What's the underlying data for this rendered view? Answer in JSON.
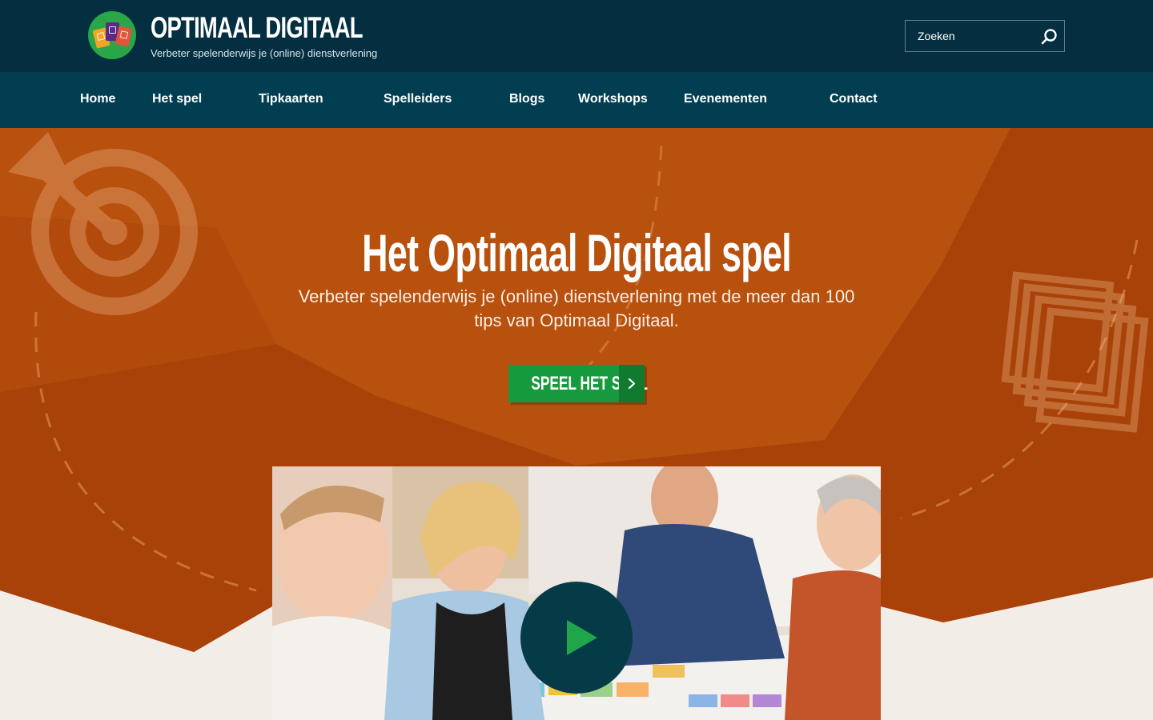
{
  "header": {
    "brand_title": "OPTIMAAL DIGITAAL",
    "brand_tagline": "Verbeter spelenderwijs je (online) dienstverlening",
    "search_placeholder": "Zoeken"
  },
  "nav": {
    "items": [
      {
        "label": "Home"
      },
      {
        "label": "Het spel"
      },
      {
        "label": "Tipkaarten"
      },
      {
        "label": "Spelleiders"
      },
      {
        "label": "Blogs"
      },
      {
        "label": "Workshops"
      },
      {
        "label": "Evenementen"
      },
      {
        "label": "Contact"
      }
    ]
  },
  "hero": {
    "title": "Het Optimaal Digitaal spel",
    "subtitle": "Verbeter spelenderwijs je (online) dienstverlening met de meer dan 100 tips van Optimaal Digitaal.",
    "cta_label": "SPEEL HET SPEL"
  },
  "icons": {
    "search": "search-icon",
    "cta_arrow": "chevron-right-icon",
    "play": "play-icon",
    "target": "target-arrow-icon",
    "cards": "card-stack-icon"
  },
  "colors": {
    "header_bg": "#032f40",
    "nav_bg": "#023e52",
    "hero_orange": "#b8500e",
    "hero_orange_dark": "#a84208",
    "cta_green": "#179a3e",
    "play_bg": "#053a47",
    "play_triangle": "#1fa64a",
    "page_bg": "#f3ede8"
  }
}
